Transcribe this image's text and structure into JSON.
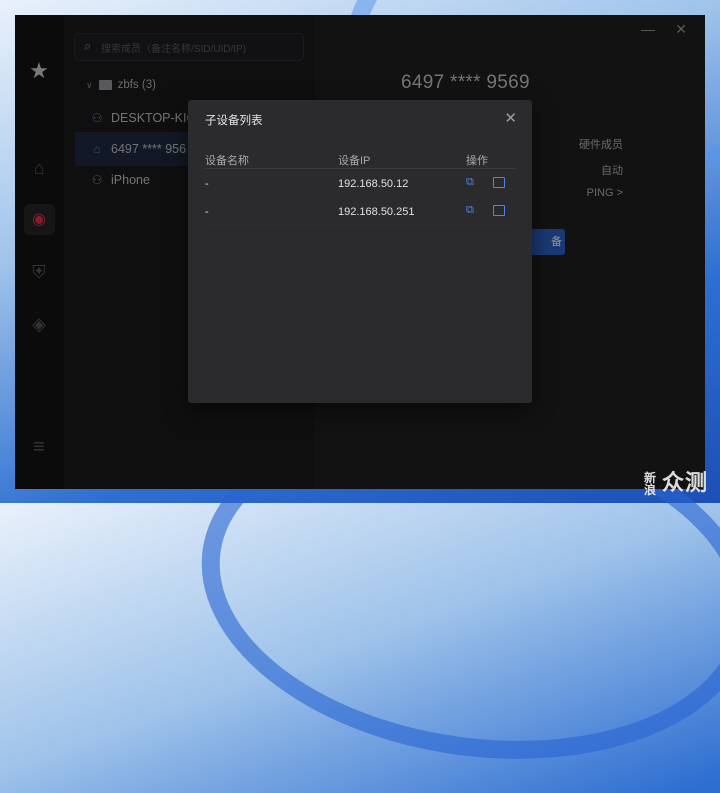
{
  "app": {
    "search_placeholder": "搜索成员（备注名称/SID/UID/IP)"
  },
  "tree": {
    "group_label": "zbfs (3)",
    "items": [
      {
        "label": "DESKTOP-KIC"
      },
      {
        "label": "6497 **** 956"
      },
      {
        "label": "iPhone"
      }
    ]
  },
  "detail": {
    "device_title": "6497 **** 9569",
    "hardware_member": "硬件成员",
    "auto": "自动",
    "ping": "PING >",
    "button_fragment": "备"
  },
  "modal": {
    "title": "子设备列表",
    "columns": [
      "设备名称",
      "设备IP",
      "操作"
    ],
    "rows": [
      {
        "name": "-",
        "ip": "192.168.50.12"
      },
      {
        "name": "-",
        "ip": "192.168.50.251"
      }
    ]
  },
  "watermark": {
    "small": "新浪",
    "big": "众测"
  },
  "colors": {
    "accent": "#2d62c8",
    "active_red": "#e8334b"
  }
}
